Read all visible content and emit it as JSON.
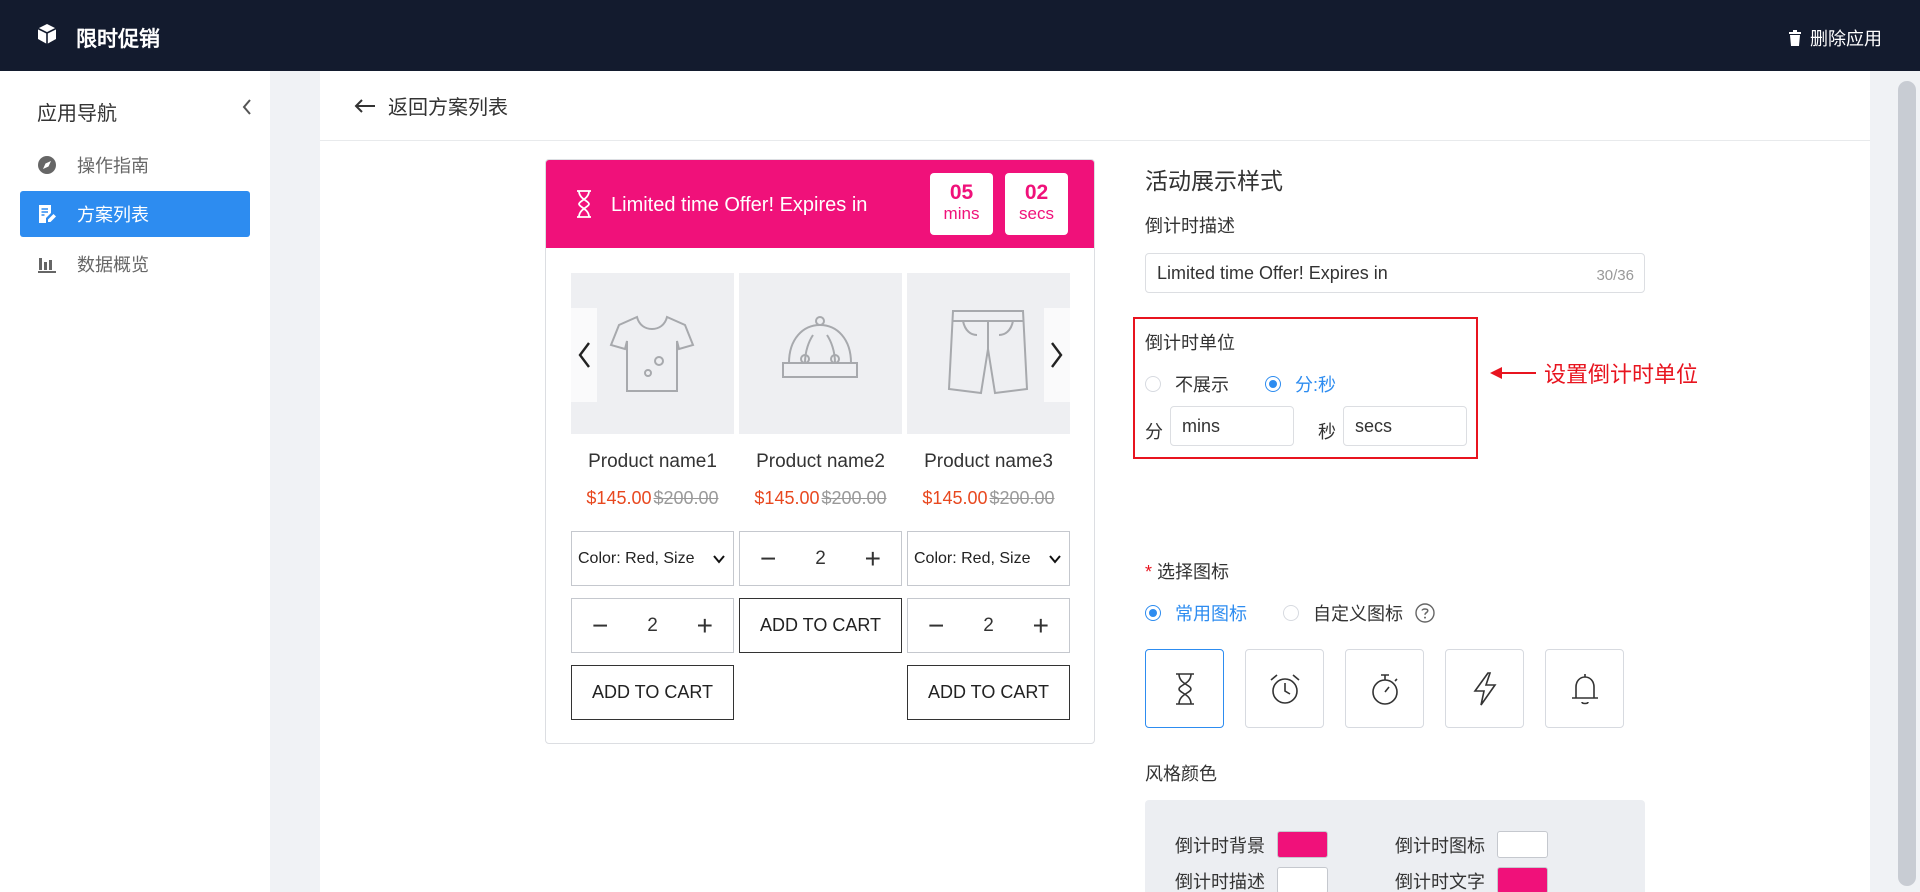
{
  "topbar": {
    "title": "限时促销",
    "delete_label": "删除应用"
  },
  "sidebar": {
    "title": "应用导航",
    "items": [
      {
        "label": "操作指南",
        "icon": "compass-icon"
      },
      {
        "label": "方案列表",
        "icon": "document-edit-icon",
        "active": true
      },
      {
        "label": "数据概览",
        "icon": "bar-chart-icon"
      }
    ]
  },
  "main": {
    "back_label": "返回方案列表"
  },
  "preview": {
    "banner_text": "Limited time Offer! Expires in",
    "minutes": "05",
    "minutes_unit": "mins",
    "seconds": "02",
    "seconds_unit": "secs",
    "products": [
      {
        "name": "Product name1",
        "price": "$145.00",
        "old_price": "$200.00",
        "icon": "tshirt-icon"
      },
      {
        "name": "Product name2",
        "price": "$145.00",
        "old_price": "$200.00",
        "icon": "hat-icon"
      },
      {
        "name": "Product name3",
        "price": "$145.00",
        "old_price": "$200.00",
        "icon": "shorts-icon"
      }
    ],
    "variant_select": "Color: Red, Size",
    "quantity": "2",
    "add_to_cart": "ADD TO CART"
  },
  "settings": {
    "title": "活动展示样式",
    "desc_label": "倒计时描述",
    "desc_value": "Limited time Offer! Expires in",
    "desc_counter": "30/36",
    "unit_label": "倒计时单位",
    "unit_options": [
      "不展示",
      "分:秒"
    ],
    "unit_selected": "分:秒",
    "min_label": "分",
    "min_value": "mins",
    "sec_label": "秒",
    "sec_value": "secs",
    "annotation": "设置倒计时单位",
    "icon_label": "选择图标",
    "required_mark": "*",
    "icon_options": [
      "常用图标",
      "自定义图标"
    ],
    "icon_selected": "常用图标",
    "icons": [
      "hourglass-icon",
      "alarm-clock-icon",
      "stopwatch-icon",
      "lightning-icon",
      "bell-icon"
    ],
    "color_label": "风格颜色",
    "colors": {
      "bg_label": "倒计时背景",
      "bg": "#f0117a",
      "icon_label": "倒计时图标",
      "icon": "#ffffff",
      "desc_label": "倒计时描述",
      "desc": "#ffffff",
      "text_label": "倒计时文字",
      "text": "#f0117a"
    }
  }
}
